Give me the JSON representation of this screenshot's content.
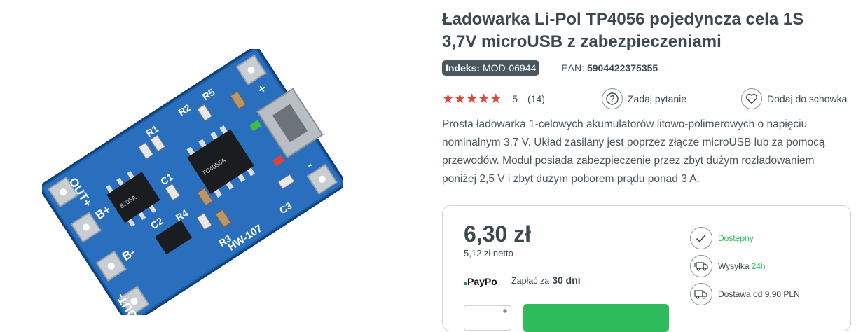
{
  "product": {
    "title": "Ładowarka Li-Pol TP4056 pojedyncza cela 1S 3,7V microUSB z zabezpieczeniami",
    "index_label": "Indeks:",
    "index_value": "MOD-06944",
    "ean_label": "EAN:",
    "ean_value": "5904422375355",
    "image": {
      "board_label": "HW-107",
      "chip_tc": "TC4056A",
      "chip_dw": "8205A",
      "pads": [
        "OUT+",
        "B+",
        "B-",
        "OUT-",
        "+",
        "-"
      ],
      "components": [
        "R1",
        "R2",
        "R3",
        "R4",
        "R5",
        "C1",
        "C2",
        "C3"
      ]
    }
  },
  "rating": {
    "stars": 5,
    "value": "5",
    "count": "(14)"
  },
  "actions": {
    "ask_label": "Zadaj pytanie",
    "wishlist_label": "Dodaj do schowka"
  },
  "description": "Prosta ładowarka 1-celowych akumulatorów litowo-polimerowych o napięciu nominalnym 3,7 V. Układ zasilany jest poprzez złącze microUSB lub za pomocą przewodów. Moduł posiada zabezpieczenie przez zbyt dużym rozładowaniem poniżej 2,5 V i  zbyt dużym poborem prądu ponad 3 A.",
  "buy_box": {
    "price": "6,30 zł",
    "price_net": "5,12 zł netto",
    "paypo_logo": "PayPo",
    "paypo_prefix": "Zapłać za",
    "paypo_days": "30 dni",
    "qty_plus": "+",
    "features": {
      "availability": "Dostępny",
      "shipping_label": "Wysyłka",
      "shipping_time": "24h",
      "delivery": "Dostawa od 9,90 PLN"
    }
  },
  "colors": {
    "accent": "#2ebb5b",
    "stars": "#e6443b",
    "badge": "#495760",
    "pcb": "#1d5fa8"
  }
}
